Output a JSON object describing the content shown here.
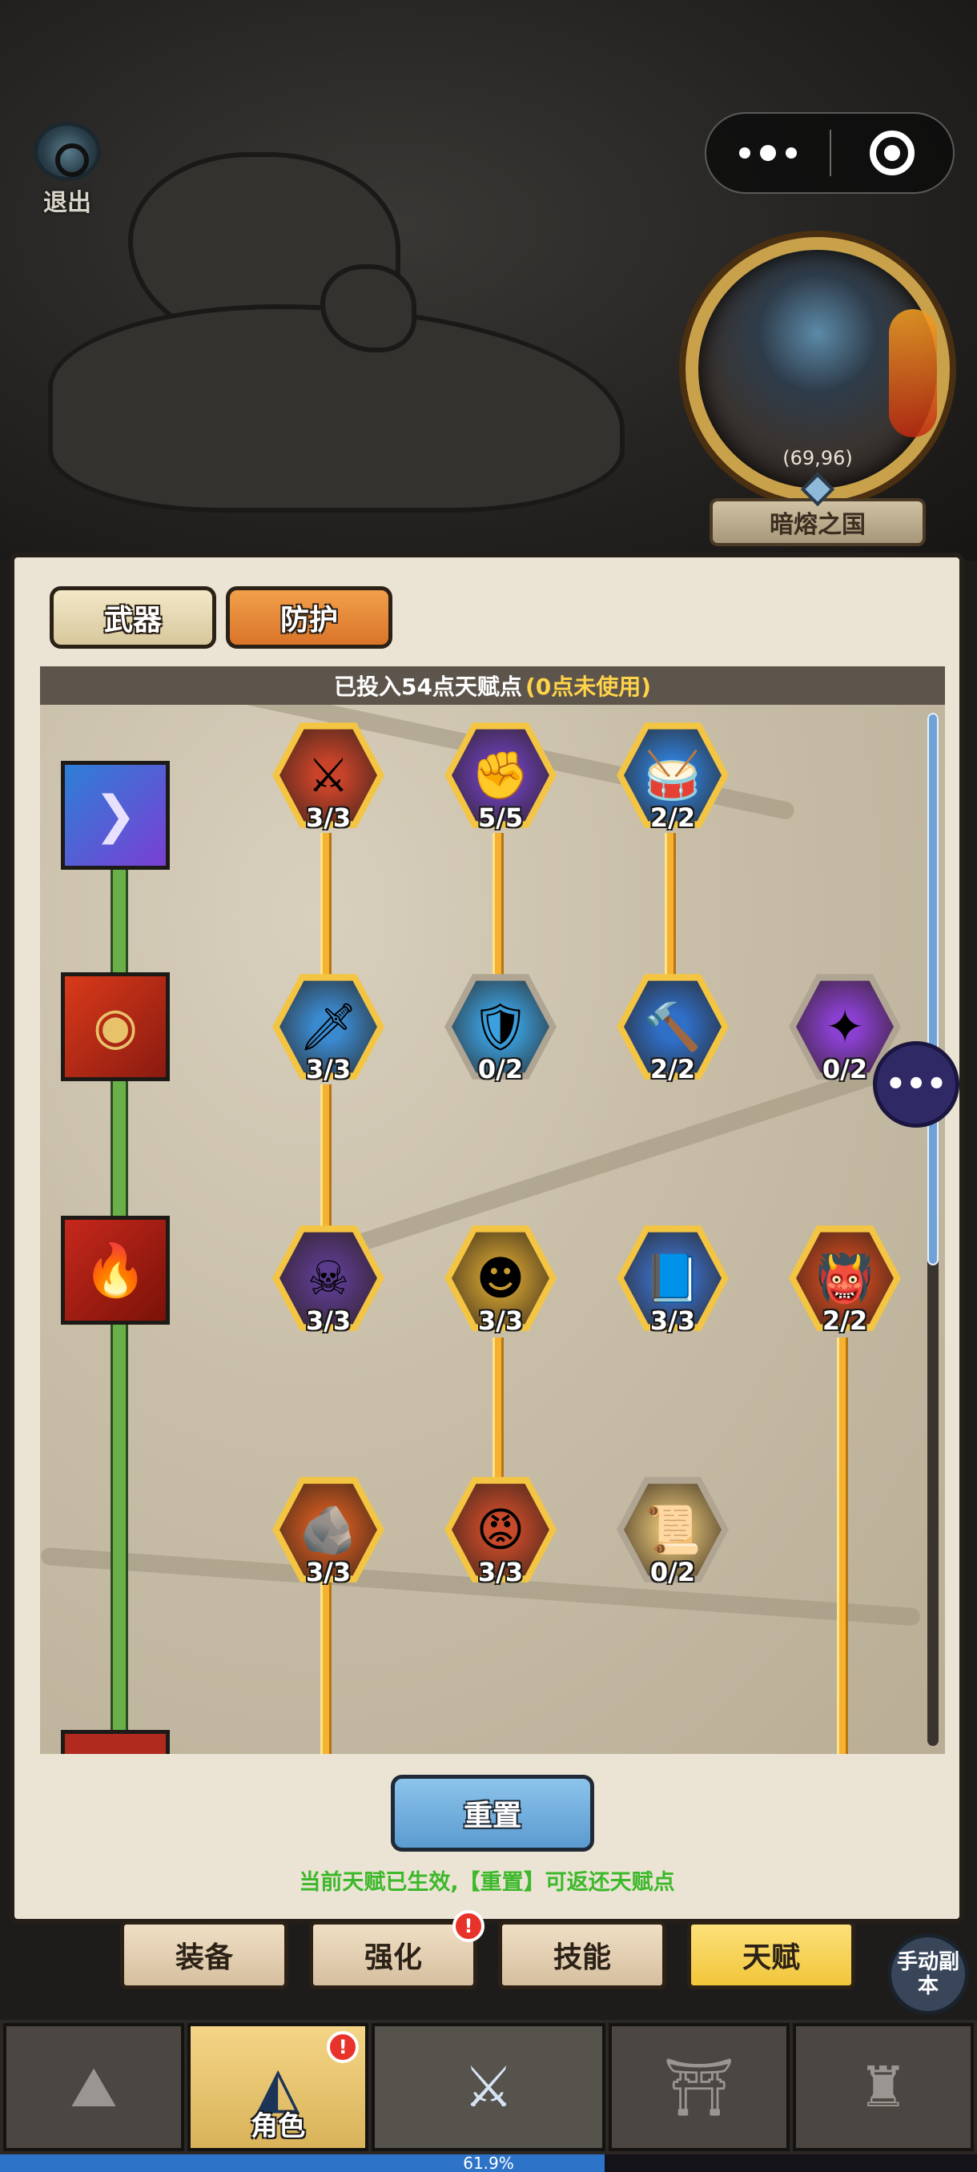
{
  "top": {
    "exit_label": "退出"
  },
  "minimap": {
    "coords": "(69,96)",
    "area_name": "暗熔之国"
  },
  "talent": {
    "tabs": [
      {
        "label": "武器"
      },
      {
        "label": "防护"
      }
    ],
    "points_text": "已投入54点天赋点",
    "unused_text": "(0点未使用)",
    "nodes": [
      {
        "row": 1,
        "col": 1,
        "icon": "sword-icon",
        "glyph": "⚔",
        "level": "3/3"
      },
      {
        "row": 1,
        "col": 2,
        "icon": "fist-icon",
        "glyph": "✊",
        "level": "5/5"
      },
      {
        "row": 1,
        "col": 3,
        "icon": "drum-icon",
        "glyph": "🥁",
        "level": "2/2"
      },
      {
        "row": 2,
        "col": 1,
        "icon": "dagger-icon",
        "glyph": "🗡",
        "level": "3/3"
      },
      {
        "row": 2,
        "col": 2,
        "icon": "wooden-shield-icon",
        "glyph": "🛡",
        "level": "0/2"
      },
      {
        "row": 2,
        "col": 3,
        "icon": "hammer-icon",
        "glyph": "🔨",
        "level": "2/2"
      },
      {
        "row": 2,
        "col": 4,
        "icon": "blade-icon",
        "glyph": "✦",
        "level": "0/2"
      },
      {
        "row": 3,
        "col": 1,
        "icon": "skull-icon",
        "glyph": "☠",
        "level": "3/3"
      },
      {
        "row": 3,
        "col": 2,
        "icon": "doll-icon",
        "glyph": "☻",
        "level": "3/3"
      },
      {
        "row": 3,
        "col": 3,
        "icon": "book-icon",
        "glyph": "📘",
        "level": "3/3"
      },
      {
        "row": 3,
        "col": 4,
        "icon": "goblin-icon",
        "glyph": "👹",
        "level": "2/2"
      },
      {
        "row": 4,
        "col": 1,
        "icon": "rock-icon",
        "glyph": "🪨",
        "level": "3/3"
      },
      {
        "row": 4,
        "col": 2,
        "icon": "orc-icon",
        "glyph": "😡",
        "level": "3/3"
      },
      {
        "row": 4,
        "col": 3,
        "icon": "scroll-icon",
        "glyph": "📜",
        "level": "0/2"
      }
    ],
    "reset_label": "重置",
    "hint": "当前天赋已生效,【重置】可返还天赋点"
  },
  "subnav": [
    {
      "label": "装备",
      "badge": ""
    },
    {
      "label": "强化",
      "badge": "!"
    },
    {
      "label": "技能",
      "badge": ""
    },
    {
      "label": "天赋",
      "badge": ""
    }
  ],
  "manual_button": "手动副本",
  "bottom_nav": [
    {
      "name": "rock-icon",
      "label": ""
    },
    {
      "name": "hooded-hero-icon",
      "label": "角色",
      "badge": "!"
    },
    {
      "name": "crossed-swords-icon",
      "label": ""
    },
    {
      "name": "fortress-icon",
      "label": ""
    },
    {
      "name": "castle-icon",
      "label": ""
    }
  ],
  "progress": {
    "value": 0.619,
    "text": "61.9%"
  },
  "colors": {
    "gold": "#f4c542",
    "panel": "#ebe4d4",
    "hint_green": "#3cb82a",
    "rail_green": "#69b04a",
    "progress_blue": "#2d74c8"
  }
}
